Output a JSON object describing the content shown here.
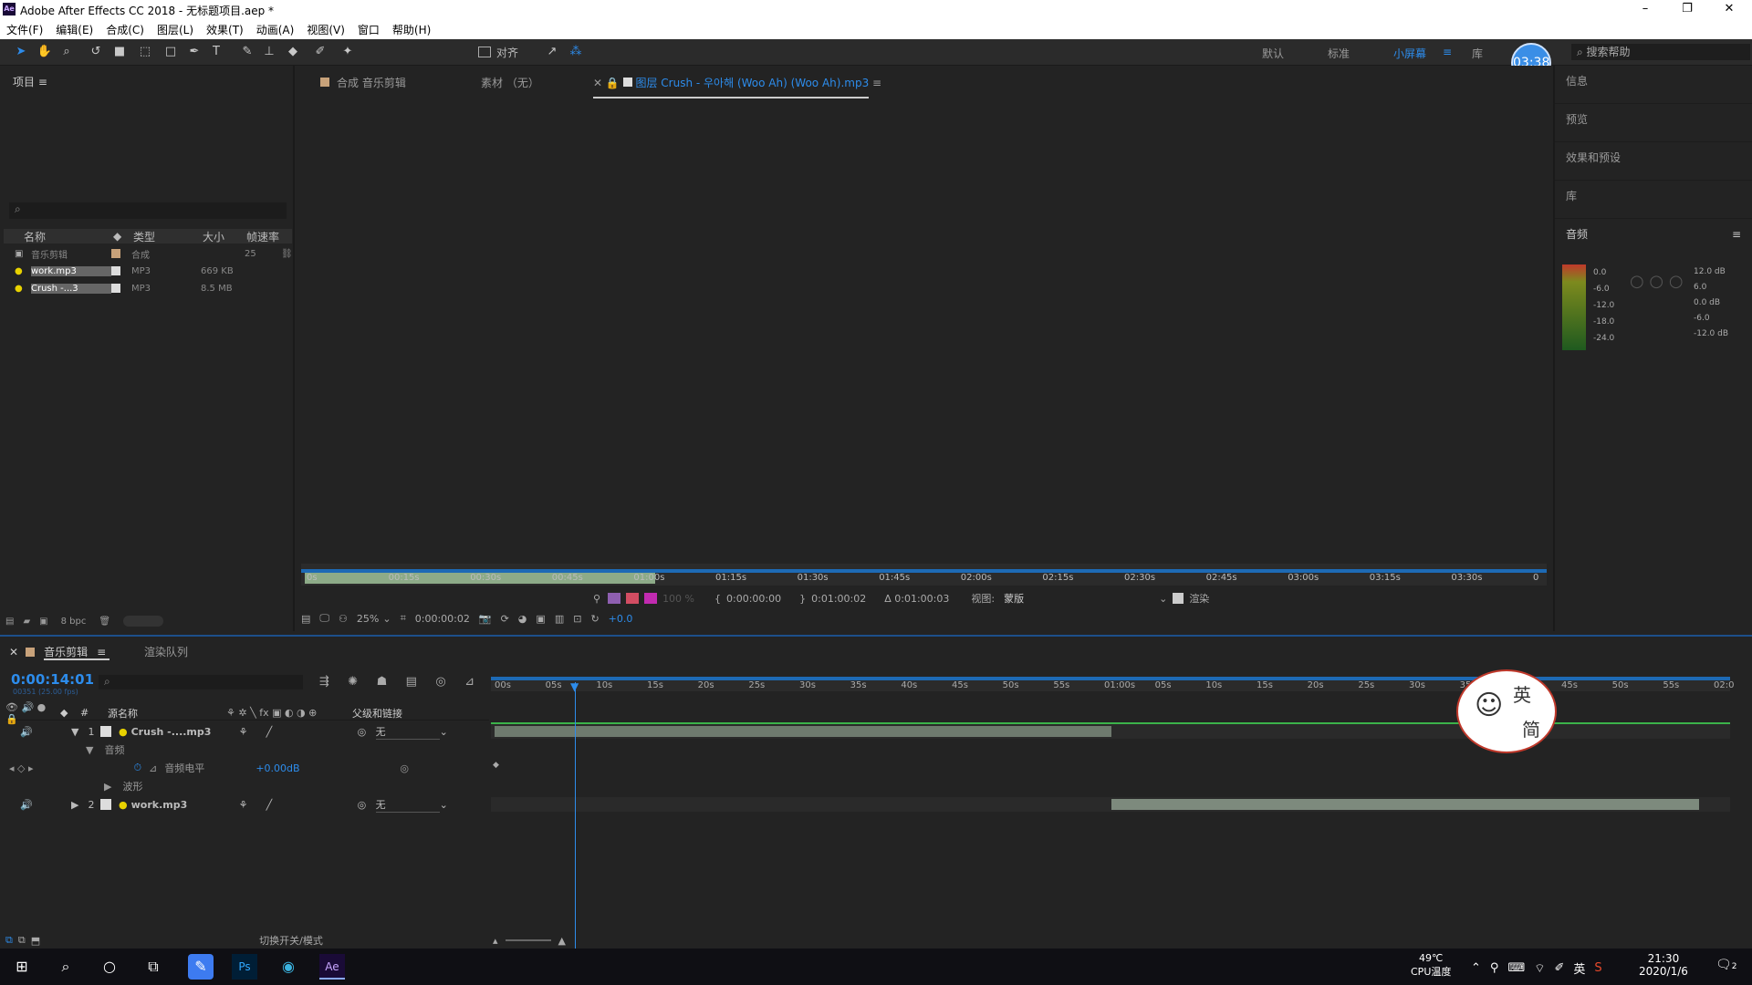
{
  "window": {
    "title": "Adobe After Effects CC 2018 - 无标题项目.aep *",
    "min": "–",
    "max": "❐",
    "close": "✕"
  },
  "menu": [
    "文件(F)",
    "编辑(E)",
    "合成(C)",
    "图层(L)",
    "效果(T)",
    "动画(A)",
    "视图(V)",
    "窗口",
    "帮助(H)"
  ],
  "toolbar": {
    "align": "对齐"
  },
  "workspaces": {
    "default": "默认",
    "standard": "标准",
    "small": "小屏幕",
    "library": "库",
    "search_placeholder": "搜索帮助"
  },
  "timer": "03:38",
  "project": {
    "title": "项目",
    "columns": [
      "名称",
      "类型",
      "大小",
      "帧速率"
    ],
    "items": [
      {
        "name": "音乐剪辑",
        "type": "合成",
        "size": "",
        "fps": "25"
      },
      {
        "name": "work.mp3",
        "type": "MP3",
        "size": "669 KB",
        "fps": ""
      },
      {
        "name": "Crush -...3",
        "type": "MP3",
        "size": "8.5 MB",
        "fps": ""
      }
    ],
    "bpc": "8 bpc"
  },
  "viewer": {
    "tabs": [
      "合成 音乐剪辑",
      "素材 （无）",
      "图层 Crush - 우아해 (Woo Ah) (Woo Ah).mp3"
    ],
    "ruler": [
      "0s",
      "00:15s",
      "00:30s",
      "00:45s",
      "01:00s",
      "01:15s",
      "01:30s",
      "01:45s",
      "02:00s",
      "02:15s",
      "02:30s",
      "02:45s",
      "03:00s",
      "03:15s",
      "03:30s",
      "0"
    ],
    "in": "0:00:00:00",
    "out": "0:01:00:02",
    "dur": "Δ 0:01:00:03",
    "view_label": "视图:",
    "view_value": "蒙版",
    "render": "渲染",
    "zoom": "25%",
    "time": "0:00:00:02",
    "exposure": "+0.0",
    "pct": "100 %"
  },
  "right": {
    "panels": [
      "信息",
      "预览",
      "效果和预设",
      "库"
    ],
    "audio": "音频",
    "levels_l": [
      "0.0",
      "-6.0",
      "-12.0",
      "-18.0",
      "-24.0"
    ],
    "levels_r": [
      "12.0 dB",
      "6.0",
      "0.0 dB",
      "-6.0",
      "-12.0 dB"
    ]
  },
  "timeline": {
    "tab": "音乐剪辑",
    "render_queue": "渲染队列",
    "timecode": "0:00:14:01",
    "frames": "00351 (25.00 fps)",
    "cols": {
      "name": "源名称",
      "parent": "父级和链接"
    },
    "ticks": [
      "00s",
      "05s",
      "10s",
      "15s",
      "20s",
      "25s",
      "30s",
      "35s",
      "40s",
      "45s",
      "50s",
      "55s",
      "01:00s",
      "05s",
      "10s",
      "15s",
      "20s",
      "25s",
      "30s",
      "35s",
      "40s",
      "45s",
      "50s",
      "55s",
      "02:0"
    ],
    "layers": [
      {
        "num": "1",
        "name": "Crush -....mp3",
        "parent": "无"
      },
      {
        "num": "2",
        "name": "work.mp3",
        "parent": "无"
      }
    ],
    "sub": {
      "audio": "音频",
      "level": "音频电平",
      "level_val": "+0.00dB",
      "wave": "波形"
    },
    "footer": "切换开关/模式"
  },
  "taskbar": {
    "temp": "49℃",
    "cpu": "CPU温度",
    "lang": "英",
    "time": "21:30",
    "date": "2020/1/6",
    "badge": "2"
  },
  "sticker": [
    "英",
    "简"
  ]
}
